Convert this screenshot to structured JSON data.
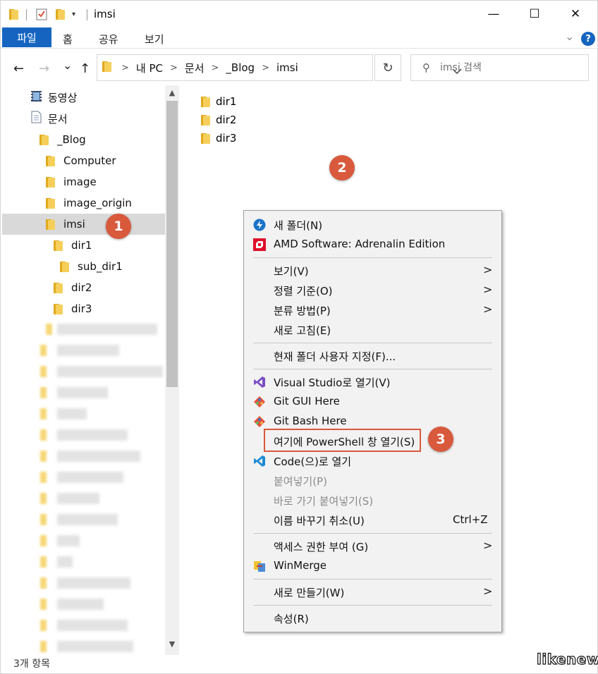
{
  "window": {
    "title": "imsi",
    "minimize": "—",
    "maximize": "☐",
    "close": "✕"
  },
  "ribbon": {
    "tabs": [
      "파일",
      "홈",
      "공유",
      "보기"
    ],
    "help": "?"
  },
  "nav": {
    "back": "←",
    "forward": "→",
    "recent": "⌄",
    "up": "↑",
    "breadcrumbs": [
      "내 PC",
      "문서",
      "_Blog",
      "imsi"
    ],
    "refresh": "↻",
    "search_placeholder": "imsi 검색"
  },
  "tree": [
    {
      "label": "동영상",
      "icon": "video-icon"
    },
    {
      "label": "문서",
      "icon": "document-icon"
    },
    {
      "label": "_Blog",
      "icon": "folder-icon"
    },
    {
      "label": "Computer",
      "icon": "folder-icon"
    },
    {
      "label": "image",
      "icon": "folder-icon"
    },
    {
      "label": "image_origin",
      "icon": "folder-icon"
    },
    {
      "label": "imsi",
      "icon": "folder-icon",
      "selected": true
    },
    {
      "label": "dir1",
      "icon": "folder-icon"
    },
    {
      "label": "sub_dir1",
      "icon": "folder-icon"
    },
    {
      "label": "dir2",
      "icon": "folder-icon"
    },
    {
      "label": "dir3",
      "icon": "folder-icon"
    }
  ],
  "files": [
    "dir1",
    "dir2",
    "dir3"
  ],
  "status": "3개 항목",
  "watermark": "likenew",
  "callouts": [
    "1",
    "2",
    "3"
  ],
  "context_menu": {
    "new_folder": "새 폴더(N)",
    "amd": "AMD Software: Adrenalin Edition",
    "view": "보기(V)",
    "sort": "정렬 기준(O)",
    "group": "분류 방법(P)",
    "refresh": "새로 고침(E)",
    "customize": "현재 폴더 사용자 지정(F)...",
    "visual_studio": "Visual Studio로 열기(V)",
    "git_gui": "Git GUI Here",
    "git_bash": "Git Bash Here",
    "powershell": "여기에 PowerShell 창 열기(S)",
    "vscode": "Code(으)로 열기",
    "paste": "붙여넣기(P)",
    "paste_shortcut": "바로 가기 붙여넣기(S)",
    "undo_rename": "이름 바꾸기 취소(U)",
    "undo_shortcut": "Ctrl+Z",
    "access": "액세스 권한 부여 (G)",
    "winmerge": "WinMerge",
    "new": "새로 만들기(W)",
    "properties": "속성(R)"
  },
  "colors": {
    "accent": "#1565c0",
    "callout": "#d9593c",
    "folder": "#f6cf5a",
    "selection": "#d9d9d9"
  }
}
